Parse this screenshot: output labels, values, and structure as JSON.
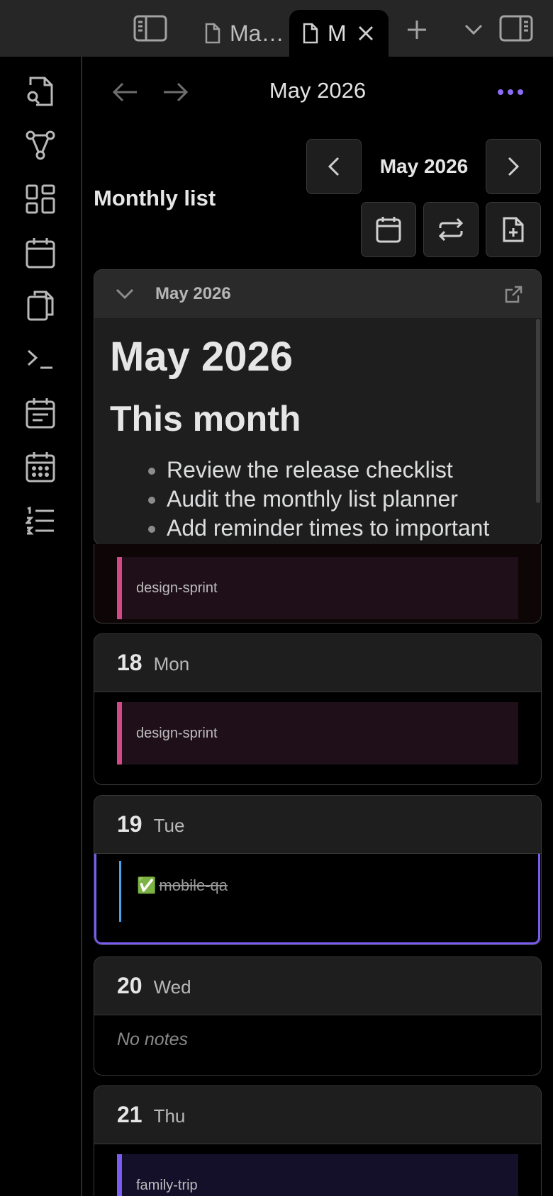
{
  "tabs": [
    {
      "title": "Ma…"
    },
    {
      "title": "M"
    }
  ],
  "header": {
    "title": "May 2026"
  },
  "controls": {
    "month_label": "May 2026",
    "view_label": "Monthly list"
  },
  "embed": {
    "title": "May 2026",
    "h1": "May 2026",
    "h2": "This month",
    "items": [
      "Review the release checklist",
      "Audit the monthly list planner",
      "Add reminder times to important"
    ]
  },
  "days": [
    {
      "entry": "design-sprint",
      "color": "#d14a87"
    },
    {
      "num": "18",
      "name": "Mon",
      "entry": "design-sprint",
      "color": "#d14a87"
    },
    {
      "num": "19",
      "name": "Tue",
      "entry": "mobile-qa",
      "done_mark": "✅",
      "color": "#4aa3e8"
    },
    {
      "num": "20",
      "name": "Wed",
      "empty_text": "No notes"
    },
    {
      "num": "21",
      "name": "Thu",
      "entry": "family-trip",
      "color": "#7a5cf0"
    }
  ],
  "accent": "#8b6cf6"
}
